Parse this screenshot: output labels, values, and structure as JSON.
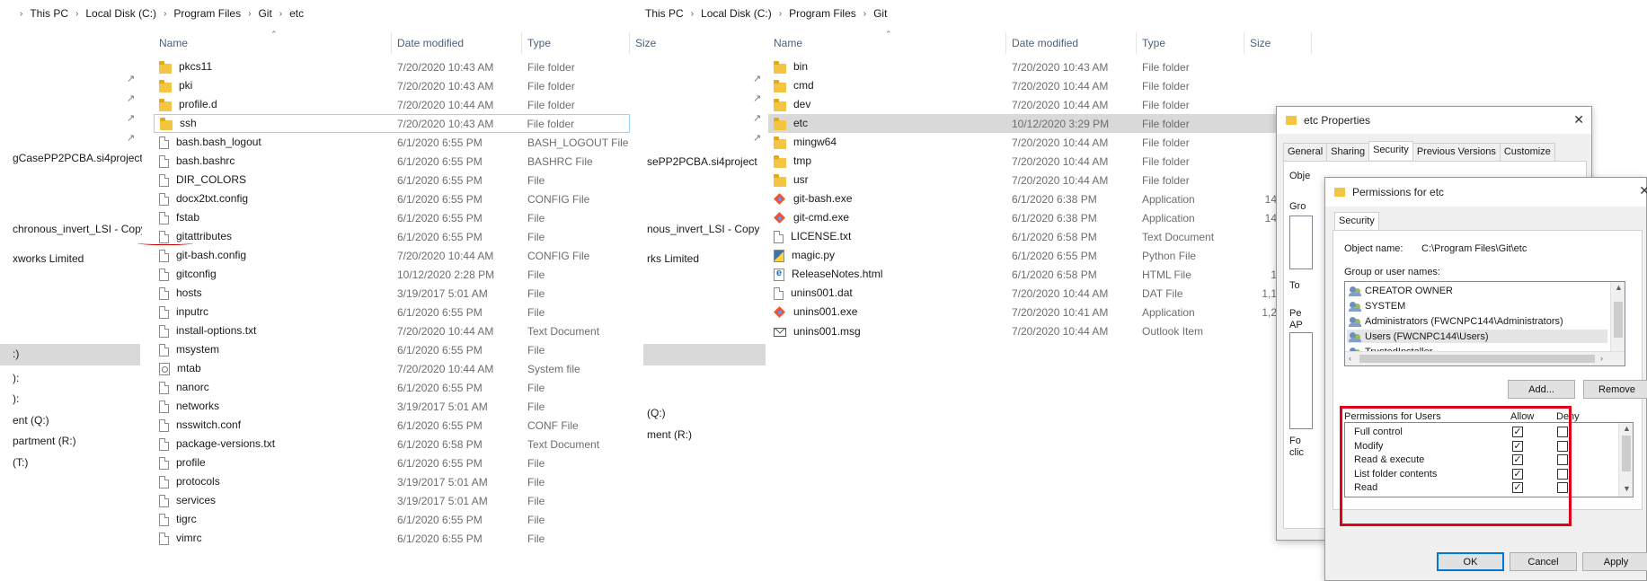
{
  "left_pane": {
    "breadcrumb": [
      "This PC",
      "Local Disk (C:)",
      "Program Files",
      "Git",
      "etc"
    ],
    "columns": [
      "Name",
      "Date modified",
      "Type",
      "Size"
    ],
    "nav_items": [
      "gCasePP2PCBA.si4project",
      "chronous_invert_LSI - Copy",
      "xworks Limited",
      ":)",
      "):",
      "):",
      "ent (Q:)",
      "partment (R:)",
      "(T:)"
    ],
    "files": [
      {
        "name": "pkcs11",
        "date": "7/20/2020 10:43 AM",
        "type": "File folder",
        "icon": "folder-icon"
      },
      {
        "name": "pki",
        "date": "7/20/2020 10:43 AM",
        "type": "File folder",
        "icon": "folder-icon"
      },
      {
        "name": "profile.d",
        "date": "7/20/2020 10:44 AM",
        "type": "File folder",
        "icon": "folder-icon"
      },
      {
        "name": "ssh",
        "date": "7/20/2020 10:43 AM",
        "type": "File folder",
        "icon": "folder-icon"
      },
      {
        "name": "bash.bash_logout",
        "date": "6/1/2020 6:55 PM",
        "type": "BASH_LOGOUT File",
        "icon": "file-icon"
      },
      {
        "name": "bash.bashrc",
        "date": "6/1/2020 6:55 PM",
        "type": "BASHRC File",
        "icon": "file-icon"
      },
      {
        "name": "DIR_COLORS",
        "date": "6/1/2020 6:55 PM",
        "type": "File",
        "icon": "file-icon"
      },
      {
        "name": "docx2txt.config",
        "date": "6/1/2020 6:55 PM",
        "type": "CONFIG File",
        "icon": "file-icon"
      },
      {
        "name": "fstab",
        "date": "6/1/2020 6:55 PM",
        "type": "File",
        "icon": "file-icon"
      },
      {
        "name": "gitattributes",
        "date": "6/1/2020 6:55 PM",
        "type": "File",
        "icon": "file-icon"
      },
      {
        "name": "git-bash.config",
        "date": "7/20/2020 10:44 AM",
        "type": "CONFIG File",
        "icon": "file-icon"
      },
      {
        "name": "gitconfig",
        "date": "10/12/2020 2:28 PM",
        "type": "File",
        "icon": "file-icon"
      },
      {
        "name": "hosts",
        "date": "3/19/2017 5:01 AM",
        "type": "File",
        "icon": "file-icon"
      },
      {
        "name": "inputrc",
        "date": "6/1/2020 6:55 PM",
        "type": "File",
        "icon": "file-icon"
      },
      {
        "name": "install-options.txt",
        "date": "7/20/2020 10:44 AM",
        "type": "Text Document",
        "icon": "file-icon"
      },
      {
        "name": "msystem",
        "date": "6/1/2020 6:55 PM",
        "type": "File",
        "icon": "file-icon"
      },
      {
        "name": "mtab",
        "date": "7/20/2020 10:44 AM",
        "type": "System file",
        "icon": "system-file-icon"
      },
      {
        "name": "nanorc",
        "date": "6/1/2020 6:55 PM",
        "type": "File",
        "icon": "file-icon"
      },
      {
        "name": "networks",
        "date": "3/19/2017 5:01 AM",
        "type": "File",
        "icon": "file-icon"
      },
      {
        "name": "nsswitch.conf",
        "date": "6/1/2020 6:55 PM",
        "type": "CONF File",
        "icon": "file-icon"
      },
      {
        "name": "package-versions.txt",
        "date": "6/1/2020 6:58 PM",
        "type": "Text Document",
        "icon": "file-icon"
      },
      {
        "name": "profile",
        "date": "6/1/2020 6:55 PM",
        "type": "File",
        "icon": "file-icon"
      },
      {
        "name": "protocols",
        "date": "3/19/2017 5:01 AM",
        "type": "File",
        "icon": "file-icon"
      },
      {
        "name": "services",
        "date": "3/19/2017 5:01 AM",
        "type": "File",
        "icon": "file-icon"
      },
      {
        "name": "tigrc",
        "date": "6/1/2020 6:55 PM",
        "type": "File",
        "icon": "file-icon"
      },
      {
        "name": "vimrc",
        "date": "6/1/2020 6:55 PM",
        "type": "File",
        "icon": "file-icon"
      }
    ]
  },
  "right_pane": {
    "breadcrumb": [
      "This PC",
      "Local Disk (C:)",
      "Program Files",
      "Git"
    ],
    "columns": [
      "Name",
      "Date modified",
      "Type",
      "Size"
    ],
    "nav_items": [
      "sePP2PCBA.si4project",
      "nous_invert_LSI - Copy",
      "rks Limited",
      "(Q:)",
      "ment (R:)"
    ],
    "files": [
      {
        "name": "bin",
        "date": "7/20/2020 10:43 AM",
        "type": "File folder",
        "size": "",
        "icon": "folder-icon"
      },
      {
        "name": "cmd",
        "date": "7/20/2020 10:44 AM",
        "type": "File folder",
        "size": "",
        "icon": "folder-icon"
      },
      {
        "name": "dev",
        "date": "7/20/2020 10:44 AM",
        "type": "File folder",
        "size": "",
        "icon": "folder-icon"
      },
      {
        "name": "etc",
        "date": "10/12/2020 3:29 PM",
        "type": "File folder",
        "size": "",
        "icon": "folder-icon"
      },
      {
        "name": "mingw64",
        "date": "7/20/2020 10:44 AM",
        "type": "File folder",
        "size": "",
        "icon": "folder-icon"
      },
      {
        "name": "tmp",
        "date": "7/20/2020 10:44 AM",
        "type": "File folder",
        "size": "",
        "icon": "folder-icon"
      },
      {
        "name": "usr",
        "date": "7/20/2020 10:44 AM",
        "type": "File folder",
        "size": "",
        "icon": "folder-icon"
      },
      {
        "name": "git-bash.exe",
        "date": "6/1/2020 6:38 PM",
        "type": "Application",
        "size": "14",
        "icon": "git-exe-icon"
      },
      {
        "name": "git-cmd.exe",
        "date": "6/1/2020 6:38 PM",
        "type": "Application",
        "size": "14",
        "icon": "git-exe-icon"
      },
      {
        "name": "LICENSE.txt",
        "date": "6/1/2020 6:58 PM",
        "type": "Text Document",
        "size": "",
        "icon": "text-file-icon"
      },
      {
        "name": "magic.py",
        "date": "6/1/2020 6:55 PM",
        "type": "Python File",
        "size": "",
        "icon": "python-file-icon"
      },
      {
        "name": "ReleaseNotes.html",
        "date": "6/1/2020 6:58 PM",
        "type": "HTML File",
        "size": "1",
        "icon": "html-file-icon"
      },
      {
        "name": "unins001.dat",
        "date": "7/20/2020 10:44 AM",
        "type": "DAT File",
        "size": "1,1",
        "icon": "file-icon"
      },
      {
        "name": "unins001.exe",
        "date": "7/20/2020 10:41 AM",
        "type": "Application",
        "size": "1,2",
        "icon": "git-exe-icon"
      },
      {
        "name": "unins001.msg",
        "date": "7/20/2020 10:44 AM",
        "type": "Outlook Item",
        "size": "",
        "icon": "outlook-msg-icon"
      }
    ]
  },
  "etc_properties": {
    "title": "etc Properties",
    "tabs": [
      "General",
      "Sharing",
      "Security",
      "Previous Versions",
      "Customize"
    ],
    "active_tab": "Security",
    "partial_labels": [
      "Obje",
      "Gro",
      "To",
      "Pe",
      "AP",
      "Fo",
      "clic"
    ]
  },
  "permissions": {
    "title": "Permissions for etc",
    "tab": "Security",
    "object_name_label": "Object name:",
    "object_name_value": "C:\\Program Files\\Git\\etc",
    "group_label": "Group or user names:",
    "groups": [
      "CREATOR OWNER",
      "SYSTEM",
      "Administrators (FWCNPC144\\Administrators)",
      "Users (FWCNPC144\\Users)",
      "TrustedInstaller"
    ],
    "selected_group": "Users (FWCNPC144\\Users)",
    "add_label": "Add...",
    "remove_label": "Remove",
    "perms_header": "Permissions for Users",
    "allow_label": "Allow",
    "deny_label": "Deny",
    "rows": [
      {
        "name": "Full control",
        "allow": true,
        "deny": false
      },
      {
        "name": "Modify",
        "allow": true,
        "deny": false
      },
      {
        "name": "Read & execute",
        "allow": true,
        "deny": false
      },
      {
        "name": "List folder contents",
        "allow": true,
        "deny": false
      },
      {
        "name": "Read",
        "allow": true,
        "deny": false
      }
    ],
    "ok_label": "OK",
    "cancel_label": "Cancel",
    "apply_label": "Apply",
    "highlight_color": "#e0001b"
  }
}
